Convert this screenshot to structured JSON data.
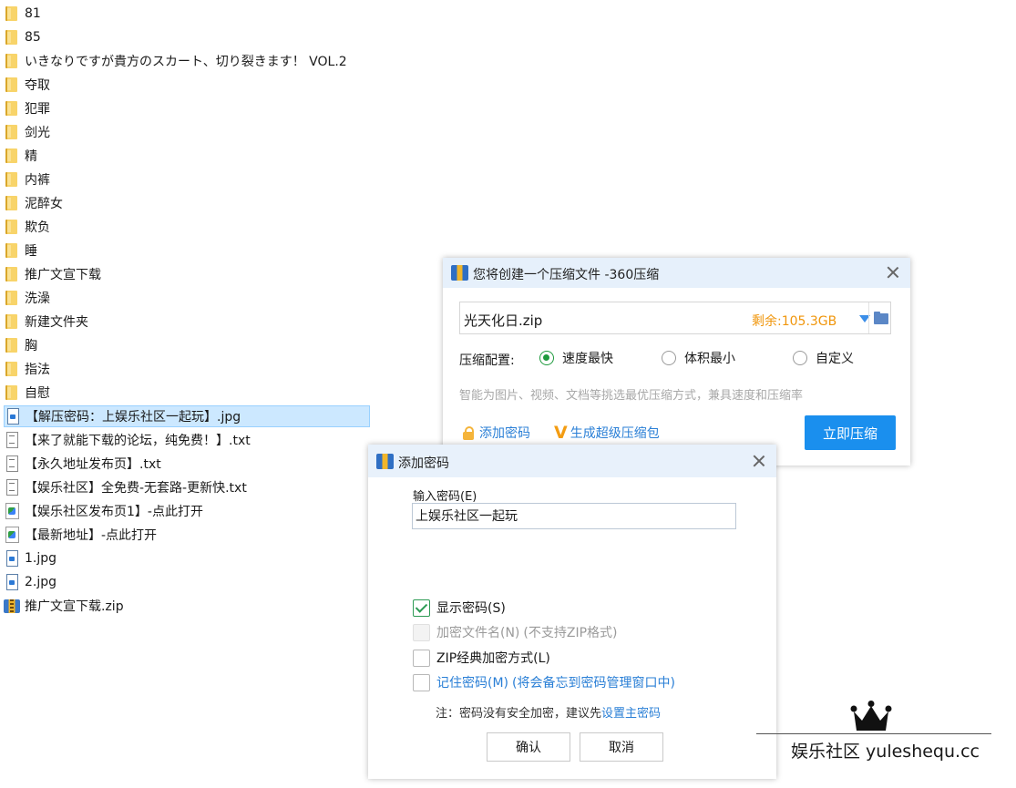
{
  "files": [
    {
      "name": "81",
      "type": "folder"
    },
    {
      "name": "85",
      "type": "folder"
    },
    {
      "name": "いきなりですが貴方のスカート、切り裂きます！ VOL.2",
      "type": "folder"
    },
    {
      "name": "夺取",
      "type": "folder"
    },
    {
      "name": "犯罪",
      "type": "folder"
    },
    {
      "name": "剑光",
      "type": "folder"
    },
    {
      "name": "精",
      "type": "folder"
    },
    {
      "name": "内裤",
      "type": "folder"
    },
    {
      "name": "泥醉女",
      "type": "folder"
    },
    {
      "name": "欺负",
      "type": "folder"
    },
    {
      "name": "睡",
      "type": "folder"
    },
    {
      "name": "推广文宣下载",
      "type": "folder"
    },
    {
      "name": "洗澡",
      "type": "folder"
    },
    {
      "name": "新建文件夹",
      "type": "folder"
    },
    {
      "name": "胸",
      "type": "folder"
    },
    {
      "name": "指法",
      "type": "folder"
    },
    {
      "name": "自慰",
      "type": "folder"
    },
    {
      "name": "【解压密码：上娱乐社区一起玩】.jpg",
      "type": "image",
      "selected": true
    },
    {
      "name": "【来了就能下载的论坛，纯免费！】.txt",
      "type": "text"
    },
    {
      "name": "【永久地址发布页】.txt",
      "type": "text"
    },
    {
      "name": "【娱乐社区】全免费-无套路-更新快.txt",
      "type": "text"
    },
    {
      "name": "【娱乐社区发布页1】-点此打开",
      "type": "shortcut"
    },
    {
      "name": "【最新地址】-点此打开",
      "type": "shortcut"
    },
    {
      "name": "1.jpg",
      "type": "image"
    },
    {
      "name": "2.jpg",
      "type": "image"
    },
    {
      "name": "推广文宣下载.zip",
      "type": "zip"
    }
  ],
  "compress_dialog": {
    "title": "您将创建一个压缩文件 -360压缩",
    "filename": "光天化日.zip",
    "free_space": "剩余:105.3GB",
    "config_label": "压缩配置:",
    "options": [
      {
        "label": "速度最快",
        "checked": true
      },
      {
        "label": "体积最小",
        "checked": false
      },
      {
        "label": "自定义",
        "checked": false
      }
    ],
    "hint": "智能为图片、视频、文档等挑选最优压缩方式，兼具速度和压缩率",
    "add_password": "添加密码",
    "super_pack": "生成超级压缩包",
    "compress_button": "立即压缩"
  },
  "password_dialog": {
    "title": "添加密码",
    "input_label": "输入密码(E)",
    "password_value": "上娱乐社区一起玩",
    "show_password": "显示密码(S)",
    "encrypt_filename": "加密文件名(N)",
    "encrypt_filename_note": "(不支持ZIP格式)",
    "zip_classic": "ZIP经典加密方式(L)",
    "remember_password": "记住密码(M)",
    "remember_note": "(将会备忘到密码管理窗口中)",
    "note_prefix": "注：密码没有安全加密，建议先",
    "note_link": "设置主密码",
    "ok_button": "确认",
    "cancel_button": "取消"
  },
  "watermark": {
    "text": "娱乐社区 yuleshequ.cc"
  },
  "colors": {
    "accent_blue": "#1a8fee",
    "free_space_orange": "#f0960c",
    "check_green": "#1e9a3d",
    "selection_bg": "#cce8ff"
  }
}
